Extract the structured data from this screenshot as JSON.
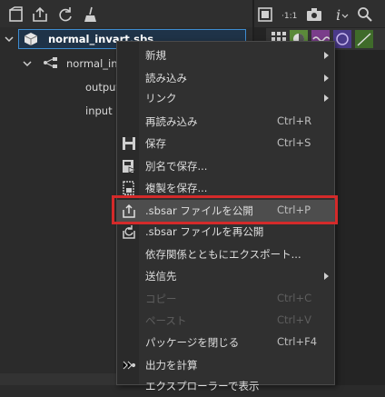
{
  "tree": {
    "package_name": "normal_invart.sbs",
    "graph_name": "normal_inv",
    "nodes": [
      "output",
      "input"
    ]
  },
  "menu": {
    "items": [
      {
        "label": "新規",
        "shortcut": "",
        "submenu": true,
        "disabled": false
      },
      {
        "label": "読み込み",
        "shortcut": "",
        "submenu": true,
        "disabled": false
      },
      {
        "label": "リンク",
        "shortcut": "",
        "submenu": true,
        "disabled": false
      },
      {
        "label": "再読み込み",
        "shortcut": "Ctrl+R",
        "submenu": false,
        "disabled": false
      },
      {
        "label": "保存",
        "shortcut": "Ctrl+S",
        "submenu": false,
        "disabled": false
      },
      {
        "label": "別名で保存...",
        "shortcut": "",
        "submenu": false,
        "disabled": false
      },
      {
        "label": "複製を保存...",
        "shortcut": "",
        "submenu": false,
        "disabled": false
      },
      {
        "label": ".sbsar ファイルを公開",
        "shortcut": "Ctrl+P",
        "submenu": false,
        "disabled": false,
        "highlighted": true
      },
      {
        "label": ".sbsar ファイルを再公開",
        "shortcut": "",
        "submenu": false,
        "disabled": false
      },
      {
        "label": "依存関係とともにエクスポート...",
        "shortcut": "",
        "submenu": false,
        "disabled": false
      },
      {
        "label": "送信先",
        "shortcut": "",
        "submenu": true,
        "disabled": false
      },
      {
        "label": "コピー",
        "shortcut": "Ctrl+C",
        "submenu": false,
        "disabled": true
      },
      {
        "label": "ペースト",
        "shortcut": "Ctrl+V",
        "submenu": false,
        "disabled": true
      },
      {
        "label": "パッケージを閉じる",
        "shortcut": "Ctrl+F4",
        "submenu": false,
        "disabled": false
      },
      {
        "label": "出力を計算",
        "shortcut": "",
        "submenu": false,
        "disabled": false
      },
      {
        "label": "エクスプローラーで表示",
        "shortcut": "",
        "submenu": false,
        "disabled": false
      }
    ]
  },
  "colors": {
    "accent_outline": "#d42a2a",
    "selection": "#3e8cd0"
  }
}
